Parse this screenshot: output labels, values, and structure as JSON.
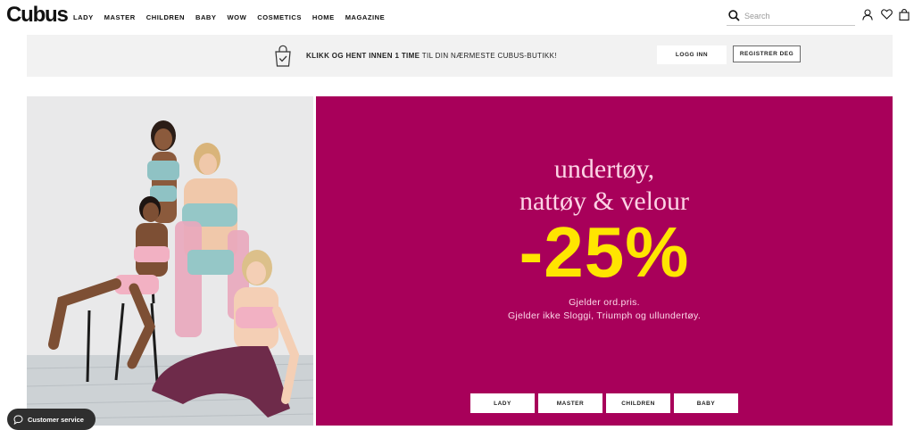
{
  "header": {
    "logo": "Cubus",
    "nav": [
      "LADY",
      "MASTER",
      "CHILDREN",
      "BABY",
      "WOW",
      "COSMETICS",
      "HOME",
      "MAGAZINE"
    ],
    "search_placeholder": "Search",
    "icons": [
      "search-icon",
      "account-icon",
      "wishlist-heart-icon",
      "cart-bag-icon"
    ]
  },
  "promo": {
    "bold_text": "KLIKK OG HENT INNEN 1 TIME",
    "rest_text": " TIL DIN NÆRMESTE CUBUS-BUTIKK!",
    "login_label": "LOGG INN",
    "register_label": "REGISTRER DEG",
    "icon": "shopping-bag-check-icon"
  },
  "hero": {
    "headline_line1": "undertøy,",
    "headline_line2": "nattøy & velour",
    "discount": "-25%",
    "note_line1": "Gjelder ord.pris.",
    "note_line2": "Gjelder ikke Sloggi, Triumph og ullundertøy.",
    "categories": [
      "LADY",
      "MASTER",
      "CHILDREN",
      "BABY"
    ]
  },
  "customer_service": {
    "label": "Customer service",
    "icon": "chat-bubble-icon"
  },
  "colors": {
    "panel": "#a8005a",
    "headline": "#fcd3e5",
    "discount": "#ffe500",
    "promo_bg": "#f2f2f2",
    "cs_bg": "#2f2f2f"
  }
}
